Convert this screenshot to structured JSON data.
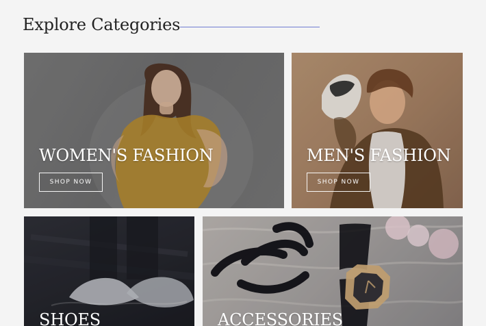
{
  "header": {
    "title": "Explore Categories"
  },
  "categories": [
    {
      "key": "women",
      "label": "WOMEN'S FASHION",
      "button": "SHOP NOW"
    },
    {
      "key": "men",
      "label": "MEN'S FASHION",
      "button": "SHOP NOW"
    },
    {
      "key": "shoes",
      "label": "SHOES"
    },
    {
      "key": "accessories",
      "label": "ACCESSORIES"
    }
  ],
  "colors": {
    "page_bg": "#f4f4f4",
    "title_text": "#222222",
    "title_line": "#6e7bd1",
    "overlay_text": "#ffffff"
  }
}
